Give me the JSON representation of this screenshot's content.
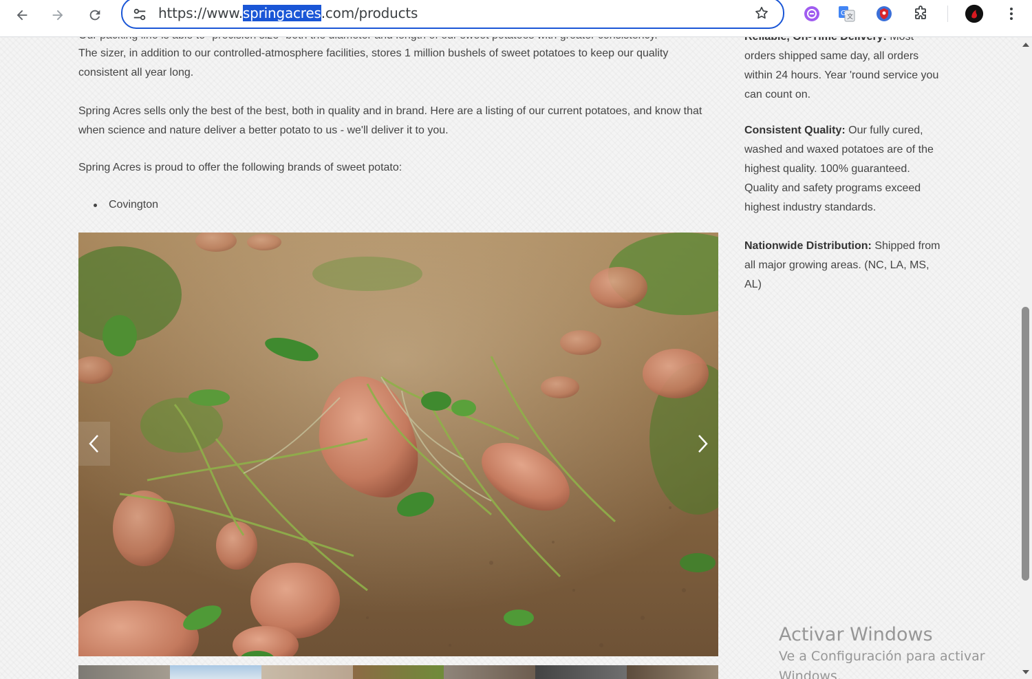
{
  "browser": {
    "url_prefix": "https://www.",
    "url_highlight": "springacres",
    "url_suffix": ".com/products"
  },
  "content": {
    "cut_line": "Our packing line is able to \"precision size\" both the diameter and length of our sweet potatoes with greater consistency.",
    "paragraph1": "The sizer, in addition to our controlled-atmosphere facilities, stores 1 million bushels of sweet potatoes to keep our quality consistent all year long.",
    "paragraph2": "Spring Acres sells only the best of the best, both in quality and in brand. Here are a listing of our current potatoes, and know that when science and nature deliver a better potato to us - we'll deliver it to you.",
    "paragraph3": "Spring Acres is proud to offer the following brands of sweet potato:",
    "brands": [
      "Covington"
    ]
  },
  "sidebar": {
    "delivery_title": "Reliable, On-Time Delivery:",
    "delivery_text": "Most orders shipped same day, all orders within 24 hours. Year 'round service you can count on.",
    "quality_title": "Consistent Quality:",
    "quality_text": "Our fully cured, washed and waxed potatoes are of the highest quality. 100% guaranteed. Quality and safety programs exceed highest industry standards.",
    "distribution_title": "Nationwide Distribution:",
    "distribution_text": "Shipped from all major growing areas. (NC, LA, MS, AL)"
  },
  "watermark": {
    "title": "Activar Windows",
    "subtitle": "Ve a Configuración para activar Windows."
  },
  "icons": [
    "back-icon",
    "forward-icon",
    "reload-icon",
    "site-settings-icon",
    "bookmark-star-icon",
    "extension-purple-icon",
    "google-translate-icon",
    "extension-shield-icon",
    "extensions-puzzle-icon",
    "profile-avatar-icon",
    "menu-kebab-icon",
    "chevron-left-icon",
    "chevron-right-icon"
  ]
}
